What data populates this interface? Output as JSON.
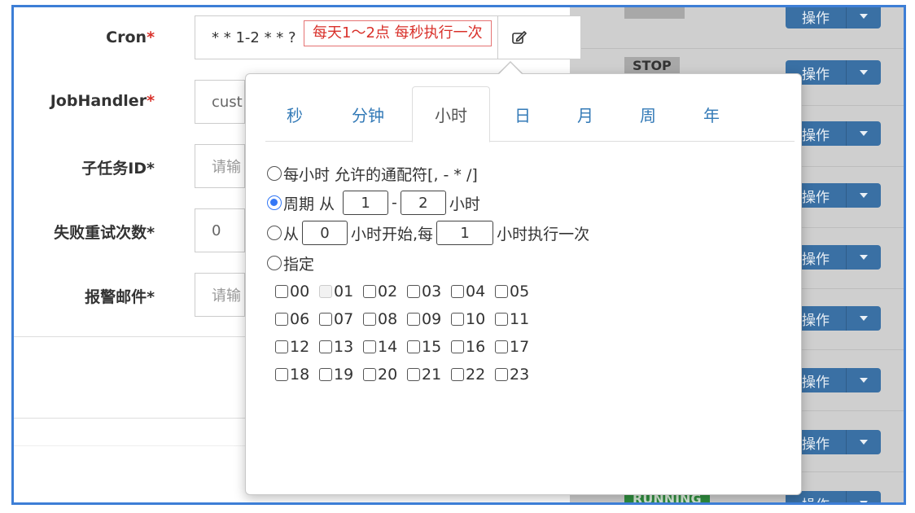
{
  "form": {
    "cron_label": "Cron",
    "cron_value": "* * 1-2 * * ?",
    "cron_description": "每天1～2点 每秒执行一次",
    "jobhandler_label": "JobHandler",
    "jobhandler_value": "cust",
    "subtask_label": "子任务ID*",
    "subtask_placeholder": "请输",
    "retry_label": "失败重试次数*",
    "retry_value": "0",
    "alarm_label": "报警邮件*",
    "alarm_placeholder": "请输",
    "required_mark": "*"
  },
  "table": {
    "status_stop": "STOP",
    "status_running": "RUNNING",
    "action_label": "操作"
  },
  "cron_editor": {
    "tabs": [
      "秒",
      "分钟",
      "小时",
      "日",
      "月",
      "周",
      "年"
    ],
    "active_tab": "小时",
    "option_every": "每小时 允许的通配符[, - * /]",
    "option_period_prefix": "周期 从",
    "period_from": "1",
    "period_sep": "-",
    "period_to": "2",
    "period_suffix": "小时",
    "option_from_prefix": "从",
    "from_start": "0",
    "from_mid": "小时开始,每",
    "from_every": "1",
    "from_suffix": "小时执行一次",
    "option_specify": "指定",
    "selected_option": "period",
    "hours": [
      "00",
      "01",
      "02",
      "03",
      "04",
      "05",
      "06",
      "07",
      "08",
      "09",
      "10",
      "11",
      "12",
      "13",
      "14",
      "15",
      "16",
      "17",
      "18",
      "19",
      "20",
      "21",
      "22",
      "23"
    ]
  },
  "colors": {
    "frame": "#3d7ed6",
    "primary_button": "#3a70a4",
    "required": "#d9312b",
    "tab_link": "#337ab7",
    "running_badge": "#2f8f3f"
  }
}
